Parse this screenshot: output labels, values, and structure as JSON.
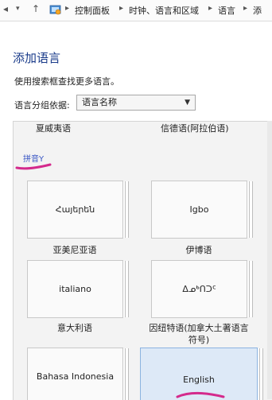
{
  "address_bar": {
    "back": "◂",
    "forward": "▾",
    "up": "↑",
    "crumbs": [
      "控制面板",
      "时钟、语言和区域",
      "语言",
      "添"
    ]
  },
  "page": {
    "title": "添加语言",
    "hint": "使用搜索框查找更多语言。",
    "group_by_label": "语言分组依据:",
    "group_by_value": "语言名称"
  },
  "panel": {
    "top_row": [
      "夏威夷语",
      "信德语(阿拉伯语)"
    ],
    "section_header": "拼音Y",
    "tiles": [
      {
        "native": "Հայերեն",
        "caption": "亚美尼亚语"
      },
      {
        "native": "Igbo",
        "caption": "伊博语"
      },
      {
        "native": "italiano",
        "caption": "意大利语"
      },
      {
        "native": "ᐃᓄᒃᑎᑐᑦ",
        "caption": "因纽特语(加拿大土著语言符号)"
      },
      {
        "native": "Bahasa Indonesia",
        "caption": ""
      },
      {
        "native": "English",
        "caption": ""
      }
    ]
  },
  "colors": {
    "title": "#1a3b8a",
    "section": "#3a57c4",
    "annotation": "#d42a8c",
    "selected_tile": "#dde9f7"
  }
}
